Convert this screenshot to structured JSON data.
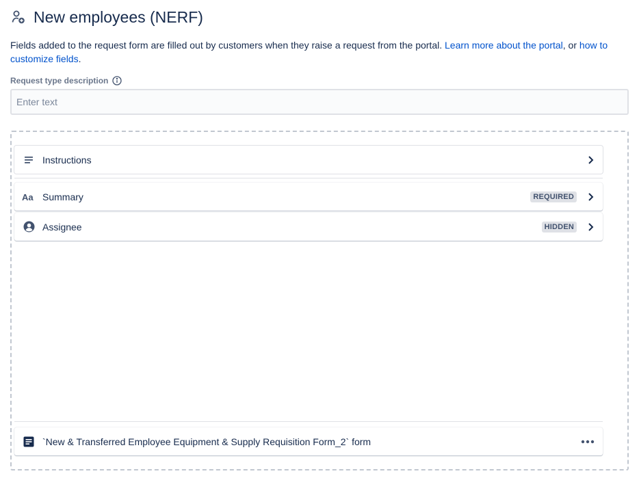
{
  "header": {
    "title": "New employees (NERF)",
    "icon": "person-add-icon"
  },
  "intro": {
    "text_before": "Fields added to the request form are filled out by customers when they raise a request from the portal. ",
    "link_portal": "Learn more about the portal",
    "text_middle": ", or ",
    "link_fields": "how to customize fields",
    "text_after": "."
  },
  "description": {
    "label": "Request type description",
    "placeholder": "Enter text",
    "value": ""
  },
  "fields": [
    {
      "label": "Instructions",
      "icon": "text-lines-icon"
    },
    {
      "label": "Summary",
      "icon": "text-format-icon",
      "badge": "REQUIRED"
    },
    {
      "label": "Assignee",
      "icon": "user-avatar-icon",
      "badge": "HIDDEN"
    }
  ],
  "form": {
    "label": "`New & Transferred Employee Equipment & Supply Requisition Form_2` form",
    "icon": "form-icon"
  },
  "colors": {
    "link": "#0052cc",
    "text": "#172b4d",
    "lozenge_bg": "#dfe1e6"
  }
}
